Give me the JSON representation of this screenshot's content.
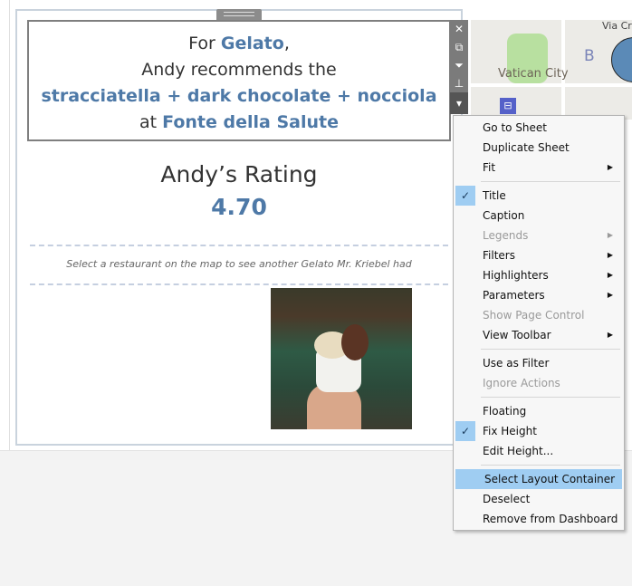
{
  "header": {
    "line1_prefix": "For ",
    "category": "Gelato",
    "line1_suffix": ",",
    "line2": "Andy recommends the",
    "flavors": "stracciatella + dark chocolate + nocciola",
    "line4_prefix": "at ",
    "restaurant": "Fonte della Salute"
  },
  "rating": {
    "title": "Andy’s Rating",
    "value": "4.70"
  },
  "hint": "Select a restaurant on the map to see another Gelato Mr. Kriebel had",
  "map": {
    "city_label": "Vatican City",
    "street_label": "Via Cr",
    "district_label": "B"
  },
  "toolbar": {
    "close": "✕",
    "open": "⧉",
    "filter": "⏚",
    "pin": "📌",
    "menu": "▾"
  },
  "menu": {
    "items": [
      {
        "label": "Go to Sheet"
      },
      {
        "label": "Duplicate Sheet"
      },
      {
        "label": "Fit",
        "submenu": true
      },
      {
        "sep": true
      },
      {
        "label": "Title",
        "checked": true
      },
      {
        "label": "Caption"
      },
      {
        "label": "Legends",
        "submenu": true,
        "disabled": true
      },
      {
        "label": "Filters",
        "submenu": true
      },
      {
        "label": "Highlighters",
        "submenu": true
      },
      {
        "label": "Parameters",
        "submenu": true
      },
      {
        "label": "Show Page Control",
        "disabled": true
      },
      {
        "label": "View Toolbar",
        "submenu": true
      },
      {
        "sep": true
      },
      {
        "label": "Use as Filter"
      },
      {
        "label": "Ignore Actions",
        "disabled": true
      },
      {
        "sep": true
      },
      {
        "label": "Floating"
      },
      {
        "label": "Fix Height",
        "checked": true
      },
      {
        "label": "Edit Height..."
      },
      {
        "sep": true
      },
      {
        "label": "Select Layout Container",
        "highlighted": true
      },
      {
        "label": "Deselect"
      },
      {
        "label": "Remove from Dashboard"
      }
    ]
  }
}
